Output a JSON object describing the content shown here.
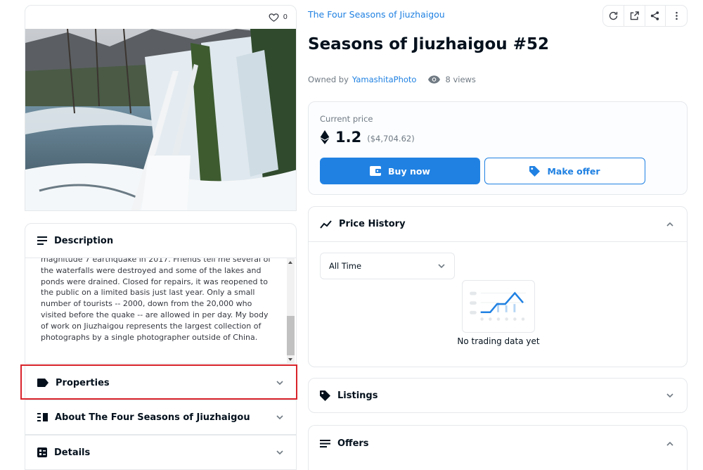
{
  "asset": {
    "favorites": "0",
    "collection": "The Four Seasons of Jiuzhaigou",
    "title": "Seasons of Jiuzhaigou #52",
    "owned_by_label": "Owned by",
    "owner": "YamashitaPhoto",
    "views": "8 views"
  },
  "description": {
    "heading": "Description",
    "text": "magnitude 7 earthquake in 2017. Friends tell me several of the waterfalls were destroyed and some of the lakes and ponds were drained. Closed for repairs, it was reopened to the public on a limited basis just last year. Only a small number of tourists -- 2000, down from the 20,000 who visited before the quake -- are allowed in per day. My body of work on Jiuzhaigou represents the largest collection of photographs by a single photographer outside of China."
  },
  "left_sections": [
    {
      "label": "Properties",
      "icon": "tag-icon"
    },
    {
      "label": "About The Four Seasons of Jiuzhaigou",
      "icon": "text-columns-icon"
    },
    {
      "label": "Details",
      "icon": "details-icon"
    }
  ],
  "price": {
    "label": "Current price",
    "value": "1.2",
    "usd": "($4,704.62)",
    "buy_label": "Buy now",
    "offer_label": "Make offer"
  },
  "price_history": {
    "heading": "Price History",
    "range": "All Time",
    "empty_text": "No trading data yet"
  },
  "right_sections": {
    "listings": "Listings",
    "offers": "Offers"
  },
  "colors": {
    "accent": "#2081e2",
    "highlight": "#d9232b",
    "border": "#e5e8eb"
  }
}
